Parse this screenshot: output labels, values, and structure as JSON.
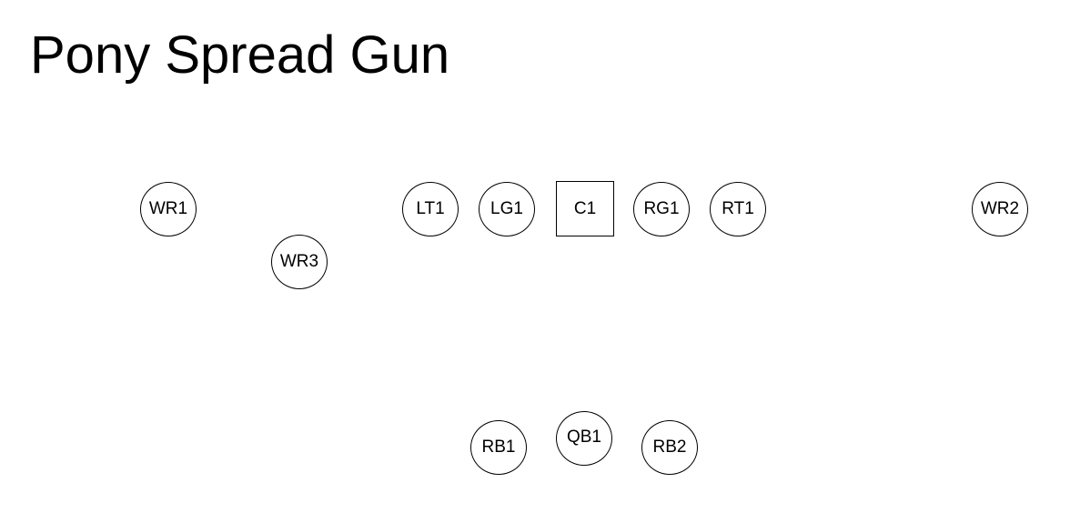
{
  "title": "Pony Spread Gun",
  "players": {
    "wr1": "WR1",
    "wr3": "WR3",
    "lt1": "LT1",
    "lg1": "LG1",
    "c1": "C1",
    "rg1": "RG1",
    "rt1": "RT1",
    "wr2": "WR2",
    "rb1": "RB1",
    "qb1": "QB1",
    "rb2": "RB2"
  }
}
